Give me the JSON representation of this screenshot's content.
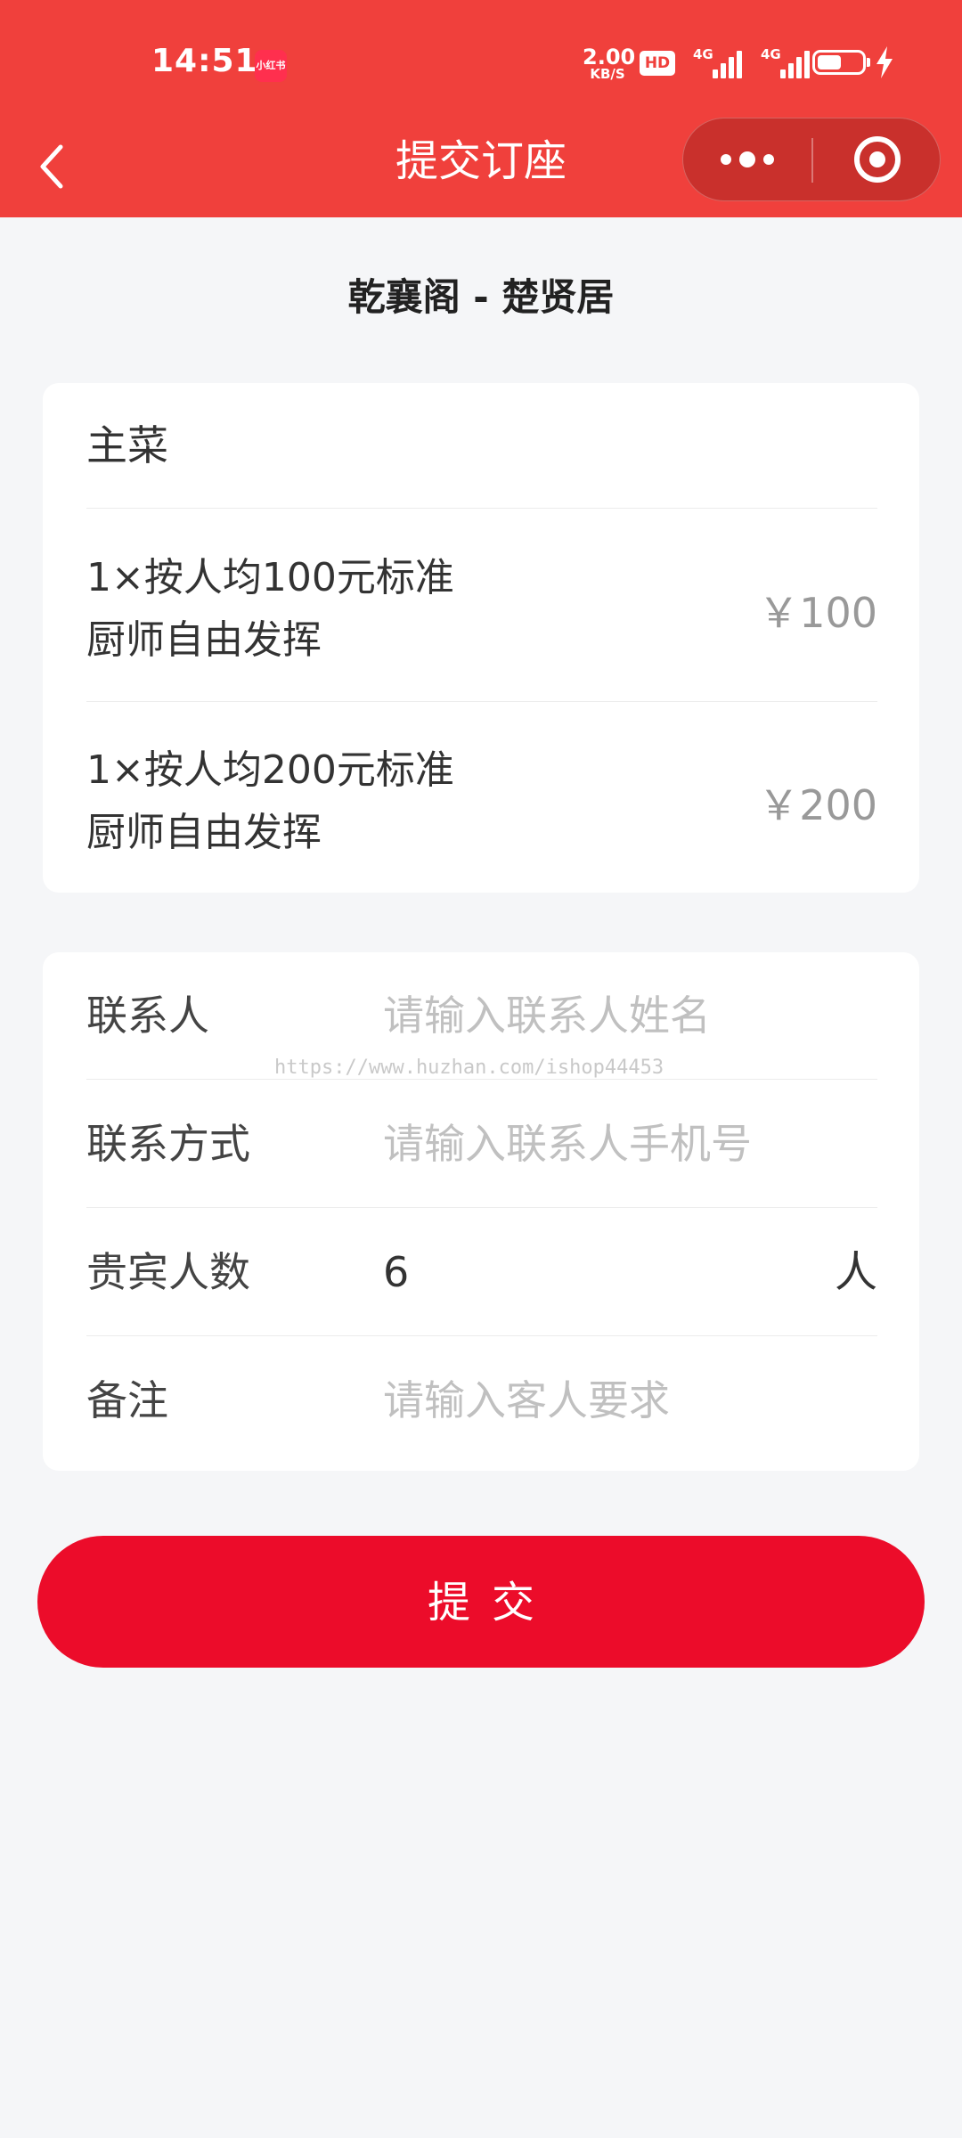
{
  "status_bar": {
    "time": "14:51",
    "app_badge": "小红书",
    "net_speed": "2.00",
    "net_unit": "KB/S",
    "hd": "HD",
    "signal1": "4G",
    "signal2": "4G",
    "battery_level": 0.55
  },
  "navbar": {
    "title": "提交订座"
  },
  "restaurant": {
    "name": "乾襄阁 - 楚贤居"
  },
  "dishes": {
    "section_title": "主菜",
    "items": [
      {
        "line1": "1×按人均100元标准",
        "line2": "厨师自由发挥",
        "price": "￥100"
      },
      {
        "line1": "1×按人均200元标准",
        "line2": "厨师自由发挥",
        "price": "￥200"
      }
    ]
  },
  "form": {
    "contact": {
      "label": "联系人",
      "placeholder": "请输入联系人姓名"
    },
    "phone": {
      "label": "联系方式",
      "placeholder": "请输入联系人手机号"
    },
    "guests": {
      "label": "贵宾人数",
      "value": "6",
      "suffix": "人"
    },
    "remark": {
      "label": "备注",
      "placeholder": "请输入客人要求"
    }
  },
  "watermark": "https://www.huzhan.com/ishop44453",
  "submit_label": "提交",
  "colors": {
    "header": "#f0403c",
    "submit": "#ec0c2a",
    "background": "#f5f6f8"
  }
}
